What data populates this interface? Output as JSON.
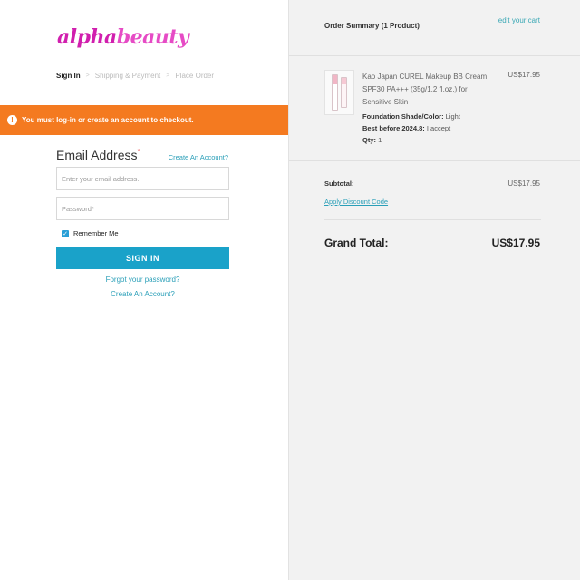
{
  "brand": {
    "logo_text_1": "alpha",
    "logo_text_2": "beauty"
  },
  "steps": [
    {
      "label": "Sign In",
      "active": true
    },
    {
      "label": "Shipping & Payment",
      "active": false
    },
    {
      "label": "Place Order",
      "active": false
    }
  ],
  "alert": {
    "icon": "alert-circle-icon",
    "text": "You must log-in or create an account to checkout.",
    "color": "#f47a20"
  },
  "login": {
    "title": "Email Address",
    "required_mark": "*",
    "create_account_link": "Create An Account?",
    "email_placeholder": "Enter your email address.",
    "password_placeholder": "Password*",
    "remember_label": "Remember Me",
    "remember_checked": true,
    "signin_button": "SIGN IN",
    "forgot_link": "Forgot your password?",
    "create_account_bottom": "Create An Account?",
    "button_color": "#1aa2c9"
  },
  "summary": {
    "title": "Order Summary (1 Product)",
    "edit_cart": "edit your cart",
    "product": {
      "name": "Kao Japan CUREL Makeup BB Cream SPF30 PA+++ (35g/1.2 fl.oz.) for Sensitive Skin",
      "price": "US$17.95",
      "attributes": [
        {
          "label": "Foundation Shade/Color:",
          "value": "Light"
        },
        {
          "label": "Best before 2024.8:",
          "value": "I accept"
        },
        {
          "label": "Qty:",
          "value": "1"
        }
      ]
    },
    "subtotal_label": "Subtotal:",
    "subtotal_value": "US$17.95",
    "discount_link": "Apply Discount Code",
    "grand_total_label": "Grand Total:",
    "grand_total_value": "US$17.95"
  }
}
